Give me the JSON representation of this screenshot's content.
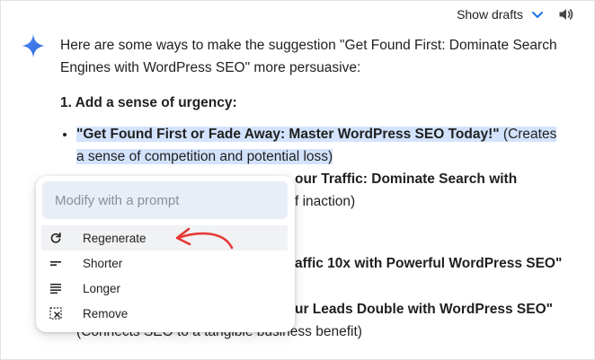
{
  "toolbar": {
    "show_drafts_label": "Show drafts"
  },
  "response": {
    "intro": "Here are some ways to make the suggestion \"Get Found First: Dominate Search Engines with WordPress SEO\" more persuasive:",
    "section_heading": "1. Add a sense of urgency:",
    "bullet1_bold": "\"Get Found First or Fade Away: Master WordPress SEO Today!\"",
    "bullet1_rest": " (Creates a sense of competition and potential loss)",
    "bullet2_bold": "our Traffic: Dominate Search with",
    "bullet2_rest": "f inaction)",
    "bullet3_bold": "affic 10x with Powerful WordPress SEO\"",
    "bullet4_bold": "ur Leads Double with WordPress SEO\"",
    "bullet4_rest": "(Connects SEO to a tangible business benefit)"
  },
  "popup": {
    "prompt_placeholder": "Modify with a prompt",
    "items": [
      {
        "label": "Regenerate",
        "icon": "refresh-icon"
      },
      {
        "label": "Shorter",
        "icon": "short-lines-icon"
      },
      {
        "label": "Longer",
        "icon": "long-lines-icon"
      },
      {
        "label": "Remove",
        "icon": "remove-selection-icon"
      }
    ]
  },
  "colors": {
    "accent": "#1a73e8",
    "highlight": "#d3e3fd",
    "annotation_arrow": "#e53935"
  }
}
